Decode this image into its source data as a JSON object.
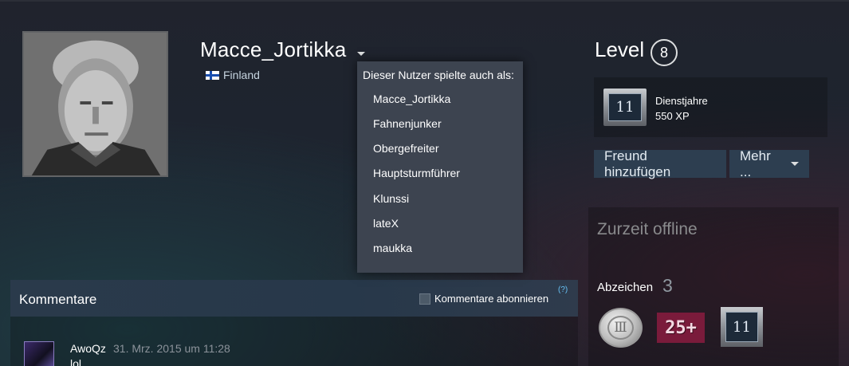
{
  "profile": {
    "name": "Macce_Jortikka",
    "country": "Finland"
  },
  "alias_menu": {
    "header": "Dieser Nutzer spielte auch als:",
    "items": [
      "Macce_Jortikka",
      "Fahnenjunker",
      "Obergefreiter",
      "Hauptsturmführer",
      "Klunssi",
      "lateX",
      "maukka"
    ]
  },
  "level": {
    "label": "Level",
    "value": "8"
  },
  "favorite_badge": {
    "icon_text": "11",
    "name": "Dienstjahre",
    "xp": "550 XP"
  },
  "buttons": {
    "add_friend": "Freund hinzufügen",
    "more": "Mehr ..."
  },
  "status": {
    "text": "Zurzeit offline"
  },
  "badges": {
    "label": "Abzeichen",
    "count": "3",
    "items": [
      {
        "icon": "lyre-coin-icon",
        "text": "Ⅲ"
      },
      {
        "icon": "years-25-icon",
        "text": "25+"
      },
      {
        "icon": "service-years-icon",
        "text": "11"
      }
    ]
  },
  "comments": {
    "title": "Kommentare",
    "subscribe_label": "Kommentare abonnieren",
    "help": "(?)",
    "entries": [
      {
        "author": "AwoQz",
        "time": "31. Mrz. 2015 um 11:28",
        "text": "lol"
      }
    ]
  },
  "colors": {
    "background": "#1d2530",
    "menu_bg": "#3d4450",
    "button_bg": "#2d3e50",
    "link": "#66c0f4",
    "muted": "#898a8c"
  }
}
